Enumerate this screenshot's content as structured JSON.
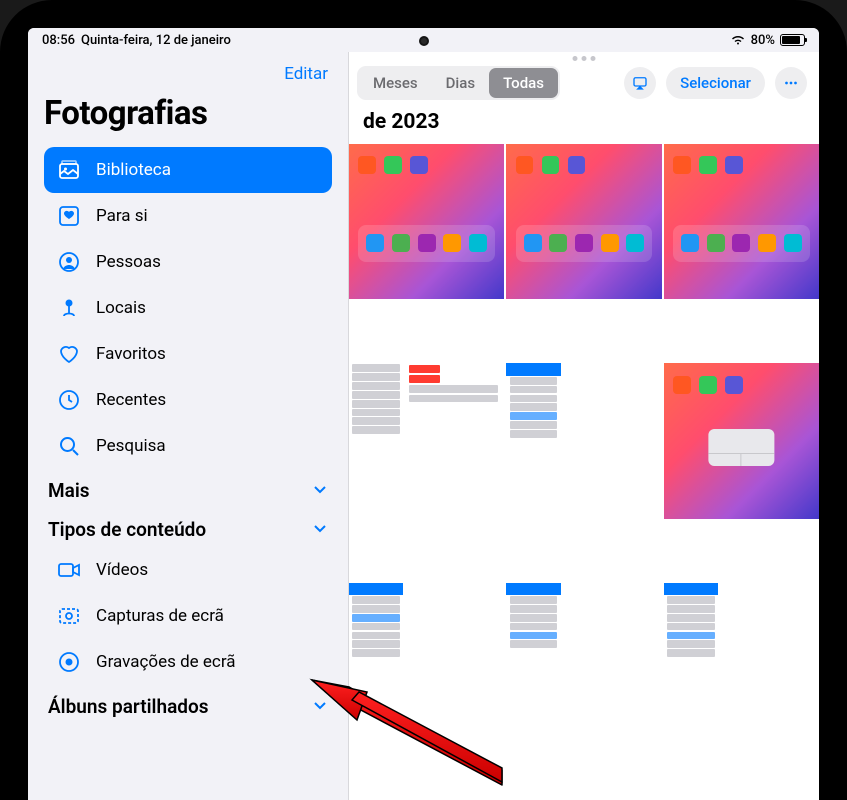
{
  "status": {
    "time": "08:56",
    "date": "Quinta-feira, 12 de janeiro",
    "battery": "80%"
  },
  "sidebar": {
    "edit": "Editar",
    "title": "Fotografias",
    "items": [
      {
        "id": "biblioteca",
        "label": "Biblioteca",
        "icon": "library-icon",
        "active": true
      },
      {
        "id": "para-si",
        "label": "Para si",
        "icon": "for-you-icon"
      },
      {
        "id": "pessoas",
        "label": "Pessoas",
        "icon": "people-icon"
      },
      {
        "id": "locais",
        "label": "Locais",
        "icon": "pin-icon"
      },
      {
        "id": "favoritos",
        "label": "Favoritos",
        "icon": "heart-icon"
      },
      {
        "id": "recentes",
        "label": "Recentes",
        "icon": "clock-icon"
      },
      {
        "id": "pesquisa",
        "label": "Pesquisa",
        "icon": "search-icon"
      }
    ],
    "sections": {
      "mais": "Mais",
      "tipos": "Tipos de conteúdo",
      "albuns": "Álbuns partilhados"
    },
    "types": [
      {
        "id": "videos",
        "label": "Vídeos",
        "icon": "video-icon"
      },
      {
        "id": "capturas",
        "label": "Capturas de ecrã",
        "icon": "screenshot-icon"
      },
      {
        "id": "gravacoes",
        "label": "Gravações de ecrã",
        "icon": "record-icon"
      }
    ]
  },
  "content": {
    "segments": {
      "meses": "Meses",
      "dias": "Dias",
      "todas": "Todas"
    },
    "selecionar": "Selecionar",
    "date_title": "de 2023"
  },
  "colors": {
    "accent": "#007aff",
    "segment_active": "#8e8e93"
  }
}
